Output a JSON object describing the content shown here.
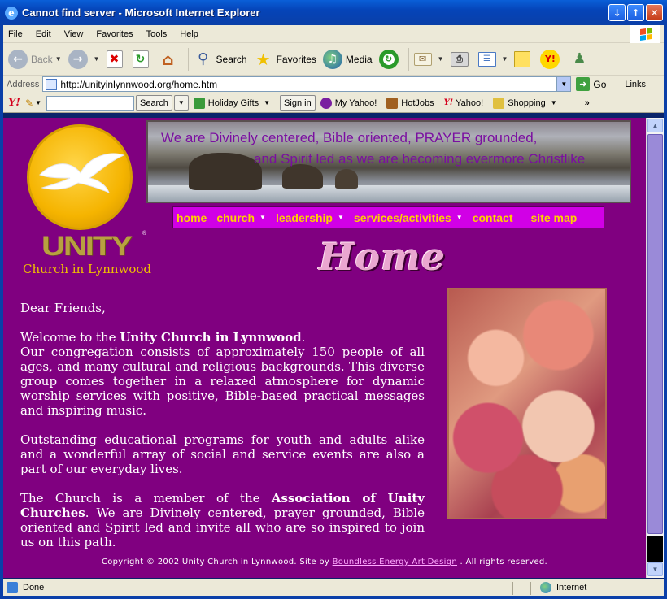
{
  "window": {
    "title": "Cannot find server - Microsoft Internet Explorer"
  },
  "menu": [
    "File",
    "Edit",
    "View",
    "Favorites",
    "Tools",
    "Help"
  ],
  "toolbar": {
    "back": "Back",
    "search": "Search",
    "favorites": "Favorites",
    "media": "Media"
  },
  "address": {
    "label": "Address",
    "url": "http://unityinlynnwood.org/home.htm",
    "go": "Go",
    "links": "Links"
  },
  "yahoo_bar": {
    "search_button": "Search",
    "holiday": "Holiday Gifts",
    "signin": "Sign in",
    "myyahoo": "My Yahoo!",
    "hotjobs": "HotJobs",
    "yahoo": "Yahoo!",
    "shopping": "Shopping"
  },
  "site": {
    "brand": "UNITY",
    "tm": "®",
    "church": "Church in Lynnwood",
    "banner_line1": "We are Divinely centered, Bible oriented, PRAYER grounded,",
    "banner_line2": "and Spirit led as we are becoming evermore Christlike",
    "nav": [
      "home",
      "church",
      "leadership",
      "services/activities",
      "contact",
      "site map"
    ],
    "page_title": "Home",
    "greeting": "Dear Friends,",
    "p1_pre": "Welcome to the ",
    "p1_bold": "Unity Church in Lynnwood",
    "p1_post": ".",
    "p1_rest": "Our congregation consists of approximately 150 people of all ages, and many cultural and religious backgrounds.  This diverse group comes together in a relaxed atmosphere for dynamic worship services with positive, Bible-based practical messages and inspiring music.",
    "p2": "Outstanding educational programs for youth and adults alike and a wonderful array of social and service events are also a part of our everyday lives.",
    "p3_pre": "The Church is a member of the ",
    "p3_bold": "Association of Unity Churches",
    "p3_post": ".  We are Divinely centered, prayer grounded, Bible oriented and Spirit led and invite all who are so inspired to join us on this path.",
    "copyright_pre": "Copyright © 2002 Unity Church in Lynnwood.  Site by ",
    "copyright_link": "Boundless Energy Art Design",
    "copyright_post": " . All rights reserved."
  },
  "status": {
    "text": "Done",
    "zone": "Internet"
  },
  "colors": {
    "page_bg": "#800080",
    "nav_bg": "#d100e6",
    "nav_text": "#ffd000"
  }
}
